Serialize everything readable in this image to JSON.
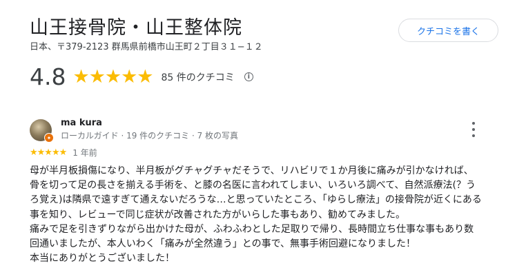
{
  "place": {
    "name": "山王接骨院・山王整体院",
    "address": "日本、〒379-2123 群馬県前橋市山王町２丁目３１−１２"
  },
  "write_review_label": "クチコミを書く",
  "summary": {
    "rating": "4.8",
    "stars": "★★★★★",
    "review_count": "85 件のクチコミ",
    "info_icon": "info-icon"
  },
  "review": {
    "reviewer_name": "ma kura",
    "reviewer_meta": "ローカルガイド · 19 件のクチコミ · 7 枚の写真",
    "badge_icon": "local-guide-badge-icon",
    "stars": "★★★★★",
    "date": "1 年前",
    "text": "母が半月板損傷になり、半月板がグチャグチャだそうで、リハビリで１か月後に痛みが引かなければ、\n骨を切って足の長さを揃える手術を、と膝の名医に言われてしまい、いろいろ調べて、自然派療法(？う\nろ覚え)は隣県で遠すぎて通えないだろうな…と思っていたところ、「ゆらし療法」の接骨院が近くにある\n事を知り、レビューで同じ症状が改善された方がいらした事もあり、勧めてみました。\n痛みで足を引きずりながら出かけた母が、ふわふわとした足取りで帰り、長時間立ち仕事な事もあり数\n回通いましたが、本人いわく「痛みが全然違う」との事で、無事手術回避になりました！\n本当にありがとうございました！"
  },
  "colors": {
    "star": "#fbbc04",
    "link_blue": "#1a73e8",
    "muted_text": "#70757a",
    "badge_orange": "#e8710a"
  }
}
